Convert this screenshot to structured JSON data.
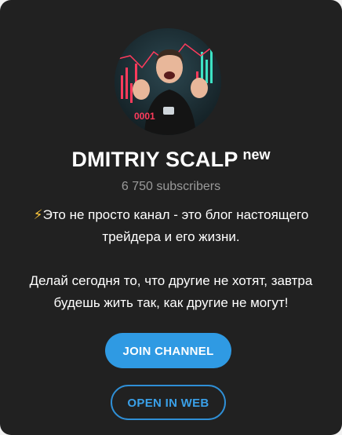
{
  "channel": {
    "name": "DMITRIY SCALP",
    "badge": "new",
    "subscribers": "6 750 subscribers",
    "avatar_alt": "channel avatar"
  },
  "description": {
    "emoji": "⚡",
    "line1": "Это не просто канал - это блог настоящего трейдера и его жизни.",
    "line2": "Делай сегодня то, что другие не хотят, завтра будешь жить так, как другие не могут!"
  },
  "actions": {
    "join_label": "JOIN CHANNEL",
    "web_label": "OPEN IN WEB"
  },
  "colors": {
    "card_bg": "#212121",
    "accent": "#2f9ae3",
    "muted_text": "#9a9a9a"
  }
}
